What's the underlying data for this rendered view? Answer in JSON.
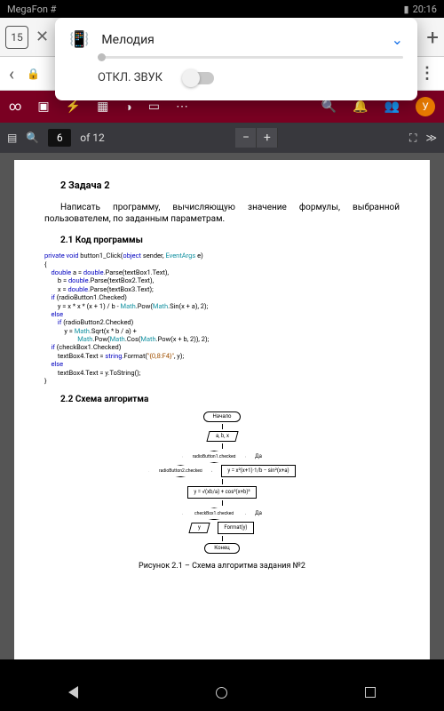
{
  "status": {
    "left": "MegaFon #",
    "time": "20:16"
  },
  "tabs": {
    "count": "15"
  },
  "pdf": {
    "page": "6",
    "total": "of 12"
  },
  "notif": {
    "title": "Мелодия",
    "mute": "ОТКЛ. ЗВУК"
  },
  "avatar": "У",
  "doc": {
    "section": "2      Задача 2",
    "intro": "Написать программу, вычисляющую значение формулы, выбранной пользователем, по заданным параметрам.",
    "h21": "2.1    Код программы",
    "h22": "2.2    Схема алгоритма",
    "caption": "Рисунок 2.1 – Схема алгоритма задания №2",
    "flow": {
      "start": "Начало",
      "input": "a, b, x",
      "d1": "radioButton1.checked",
      "d2": "radioButton2.checked",
      "d3": "checkBox1.checked",
      "p1": "y = x²(x+1)·1/b − sin²(x+a)",
      "p2": "y = √(xb/a) + cos²(x+b)³",
      "p3": "Format(y)",
      "out": "y",
      "end": "Конец",
      "yes": "Да"
    },
    "code": {
      "l1": "private void",
      "l1b": " button1_Click(",
      "l1c": "object",
      "l1d": " sender, ",
      "l1e": "EventArgs",
      "l1f": " e)",
      "l2": "{",
      "l3": "    double",
      "l3b": " a = ",
      "l3c": "double",
      "l3d": ".Parse(textBox1.Text),",
      "l4": "        b = ",
      "l4b": "double",
      "l4c": ".Parse(textBox2.Text),",
      "l5": "        x = ",
      "l5b": "double",
      "l5c": ".Parse(textBox3.Text);",
      "l6": "    if",
      "l6b": " (radioButton1.Checked)",
      "l7": "        y = x * x * (x + 1) / b - ",
      "l7b": "Math",
      "l7c": ".Pow(",
      "l7d": "Math",
      "l7e": ".Sin(x + a), 2);",
      "l8": "    else",
      "l9": "        if",
      "l9b": " (radioButton2.Checked)",
      "l10": "            y = ",
      "l10b": "Math",
      "l10c": ".Sqrt(x * b / a) +",
      "l11": "                    ",
      "l11b": "Math",
      "l11c": ".Pow(",
      "l11d": "Math",
      "l11e": ".Cos(",
      "l11f": "Math",
      "l11g": ".Pow(x + b, 2)), 2);",
      "l12": "    if",
      "l12b": " (checkBox1.Checked)",
      "l13": "        textBox4.Text = ",
      "l13b": "string",
      "l13c": ".Format(",
      "l13d": "\"{0,8:F4}\"",
      "l13e": ", y);",
      "l14": "    else",
      "l15": "        textBox4.Text = y.ToString();",
      "l16": "}"
    }
  }
}
